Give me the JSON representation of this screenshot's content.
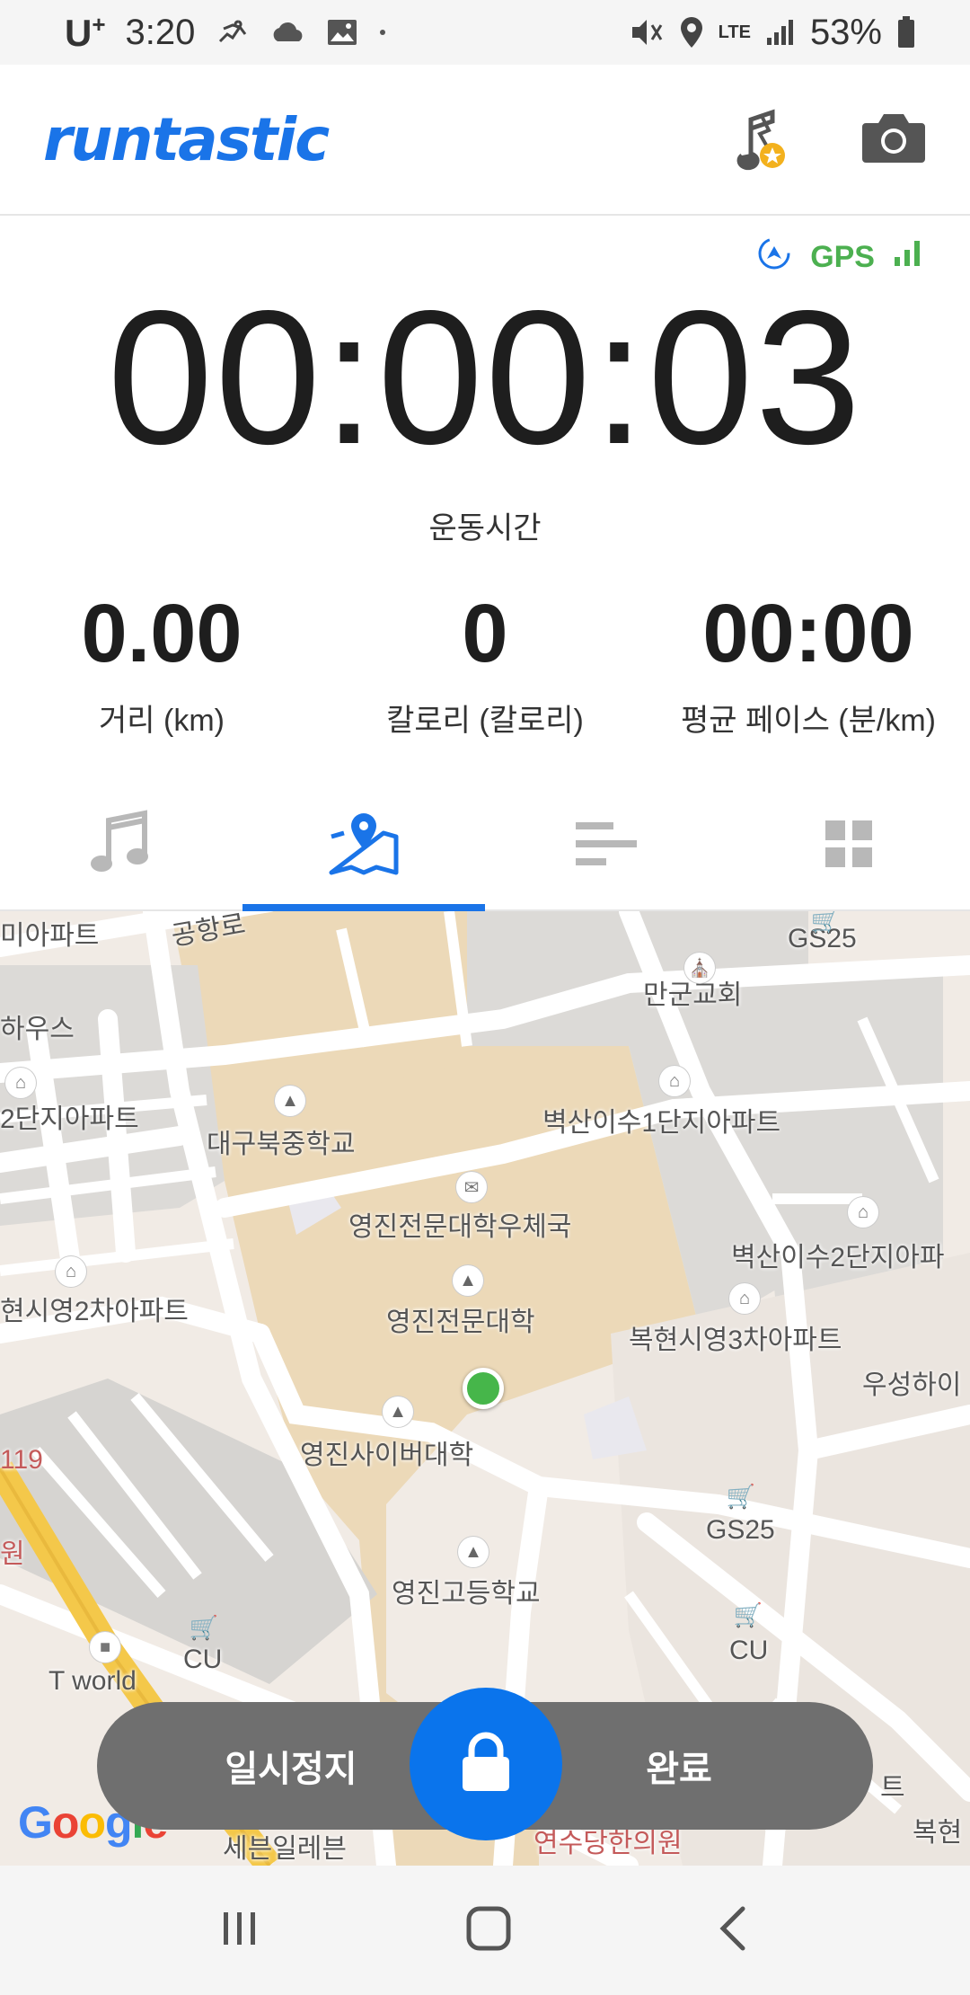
{
  "status_bar": {
    "carrier": "U",
    "carrier_sup": "+",
    "time": "3:20",
    "network": "LTE",
    "battery": "53%"
  },
  "header": {
    "logo": "runtastic",
    "icons": [
      "music-star-icon",
      "camera-icon"
    ]
  },
  "gps": {
    "label": "GPS"
  },
  "workout": {
    "duration": "00:00:03",
    "duration_label": "운동시간",
    "stats": [
      {
        "value": "0.00",
        "label": "거리 (km)"
      },
      {
        "value": "0",
        "label": "칼로리 (칼로리)"
      },
      {
        "value": "00:00",
        "label": "평균 페이스 (분/km)"
      }
    ]
  },
  "tabs": [
    {
      "icon": "music-note-icon",
      "active": false
    },
    {
      "icon": "map-icon",
      "active": true
    },
    {
      "icon": "stats-bars-icon",
      "active": false
    },
    {
      "icon": "dashboard-grid-icon",
      "active": false
    }
  ],
  "map": {
    "labels": {
      "l1": "미아파트",
      "l2": "공항로",
      "l3": "GS25",
      "l4": "만군교회",
      "l5": "하우스",
      "l6": "2단지아파트",
      "l7": "대구북중학교",
      "l8": "벽산이수1단지아파트",
      "l9": "영진전문대학우체국",
      "l10": "벽산이수2단지아파",
      "l11": "현시영2차아파트",
      "l12": "영진전문대학",
      "l13": "복현시영3차아파트",
      "l14": "우성하이",
      "l15": "119",
      "l16": "영진사이버대학",
      "l17": "GS25",
      "l18": "원",
      "l19": "영진고등학교",
      "l20": "CU",
      "l21": "CU",
      "l22": "T world",
      "l23": "세븐일레븐",
      "l24": "연수당한의원",
      "l25": "트",
      "l26": "복현"
    },
    "attribution": "Google"
  },
  "controls": {
    "pause_label": "일시정지",
    "finish_label": "완료",
    "lock_icon": "lock-icon"
  },
  "navbar": [
    "recents-icon",
    "home-icon",
    "back-icon"
  ],
  "colors": {
    "brand": "#1a74e8",
    "gps": "#4cb050",
    "lock": "#0a74ec",
    "control_bar": "#6f6f6f",
    "location": "#46b64a"
  }
}
